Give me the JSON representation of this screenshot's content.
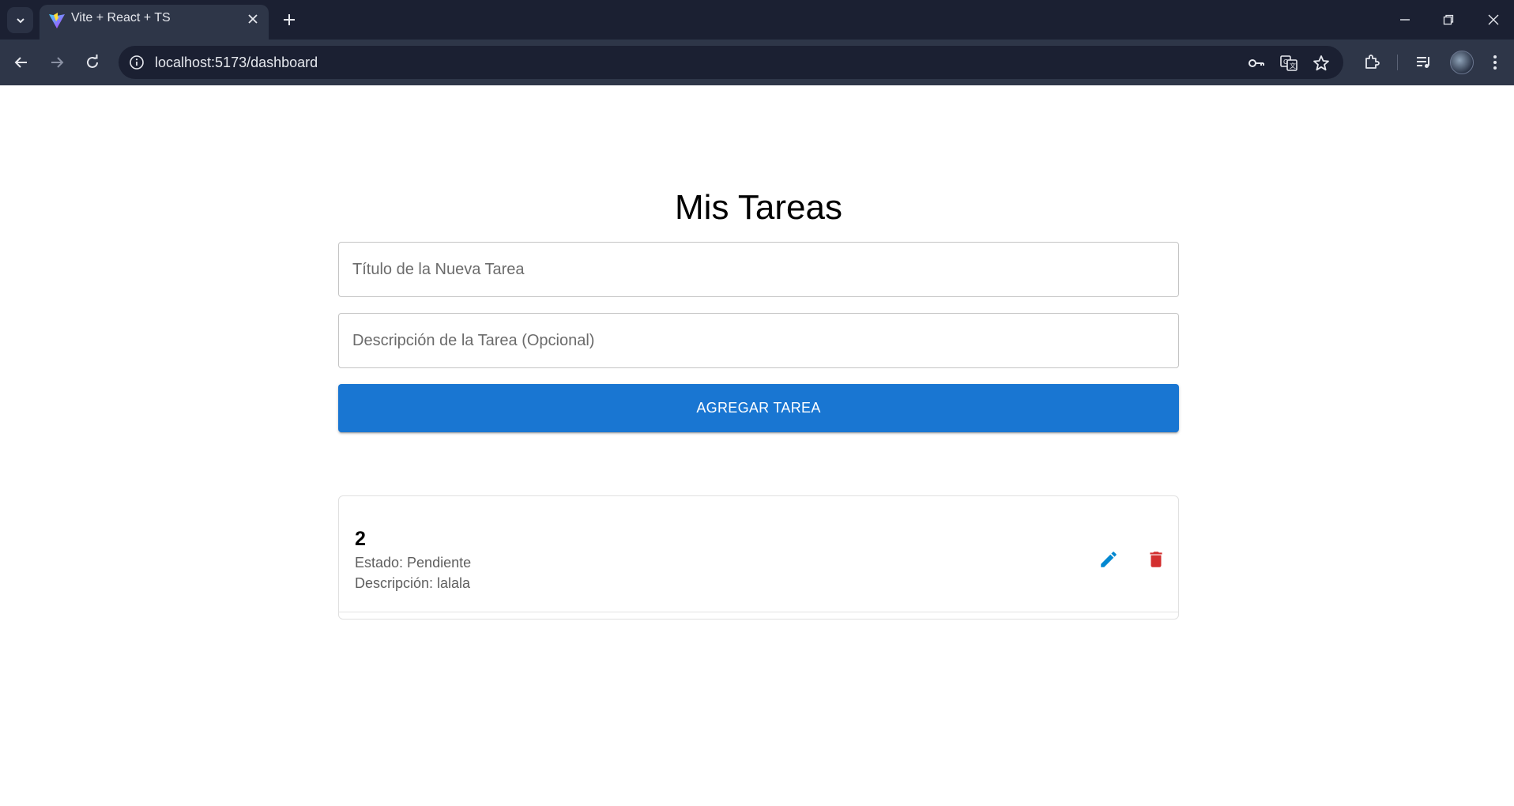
{
  "browser": {
    "tab_title": "Vite + React + TS",
    "url": "localhost:5173/dashboard"
  },
  "page": {
    "title": "Mis Tareas",
    "title_input_placeholder": "Título de la Nueva Tarea",
    "title_input_value": "",
    "description_input_placeholder": "Descripción de la Tarea (Opcional)",
    "description_input_value": "",
    "add_button_label": "AGREGAR TAREA"
  },
  "tasks": [
    {
      "title": "2",
      "status": "Estado: Pendiente",
      "description": "Descripción: lalala"
    }
  ],
  "colors": {
    "primary": "#1976d2",
    "edit_icon": "#0288d1",
    "delete_icon": "#d32f2f",
    "chrome_dark": "#1b2032",
    "chrome_toolbar": "#2e3648"
  },
  "icons": {
    "edit": "pencil-icon",
    "delete": "trash-icon"
  }
}
